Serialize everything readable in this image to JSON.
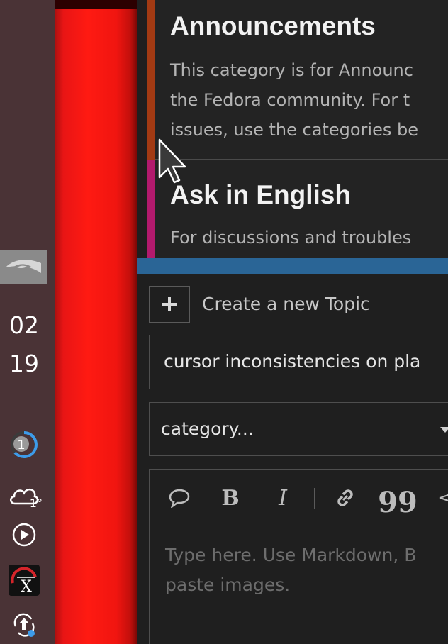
{
  "taskbar": {
    "clock": {
      "hour": "02",
      "minute": "19"
    },
    "notification_count": "1",
    "weather": {
      "temperature": "-1°",
      "icon": "cloud-icon"
    },
    "icons": [
      "nvidia-icon",
      "notification-badge",
      "cloud-icon",
      "media-play-icon",
      "app-x-icon",
      "update-icon"
    ]
  },
  "colors": {
    "panel": "#4a3336",
    "wallpaper": "#ff1a12",
    "announcements_bar": "#a23a13",
    "ask_english_bar": "#b21a6d",
    "composer_top_bar": "#2a6596"
  },
  "categories": [
    {
      "title": "Announcements",
      "desc_lines": [
        "This category is for Announc",
        "the Fedora community. For t",
        "issues, use the categories be"
      ]
    },
    {
      "title": "Ask in English",
      "desc_lines": [
        "For discussions and troubles"
      ]
    }
  ],
  "composer": {
    "create_label": "Create a new Topic",
    "title_value": "cursor inconsistencies on pla",
    "category_placeholder": "category...",
    "editor_placeholder_lines": [
      "Type here. Use Markdown, B",
      "paste images."
    ],
    "toolbar": {
      "bold": "B",
      "italic": "I",
      "blockquote": "99",
      "code": "<"
    }
  }
}
